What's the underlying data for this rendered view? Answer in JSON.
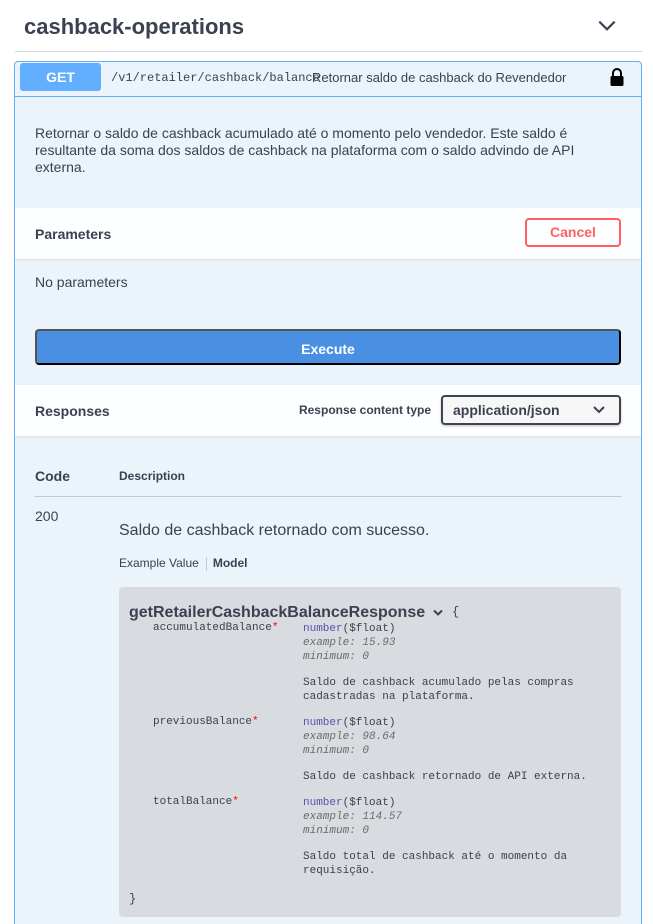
{
  "tag": {
    "title": "cashback-operations",
    "toggle_icon": "chevron-down-icon"
  },
  "operation": {
    "method": "GET",
    "path": "/v1/retailer/cashback/balance",
    "summary": "Retornar saldo de cashback do Revendedor",
    "lock_icon": "lock-icon",
    "description": "Retornar o saldo de cashback acumulado até o momento pelo vendedor. Este saldo é resultante da soma dos saldos de cashback na plataforma com o saldo advindo de API externa."
  },
  "parameters": {
    "title": "Parameters",
    "cancel_label": "Cancel",
    "empty_text": "No parameters",
    "execute_label": "Execute"
  },
  "responses": {
    "title": "Responses",
    "content_type_label": "Response content type",
    "content_type_value": "application/json",
    "col_code": "Code",
    "col_description": "Description",
    "rows": [
      {
        "code": "200",
        "description": "Saldo de cashback retornado com sucesso.",
        "tab_example": "Example Value",
        "tab_model": "Model"
      }
    ]
  },
  "model": {
    "name": "getRetailerCashbackBalanceResponse",
    "open_brace": "{",
    "close_brace": "}",
    "properties": [
      {
        "name": "accumulatedBalance",
        "required": "*",
        "type": "number",
        "format": "($float)",
        "example": "example: 15.93",
        "minimum": "minimum: 0",
        "description": "Saldo de cashback acumulado pelas compras cadastradas na plataforma."
      },
      {
        "name": "previousBalance",
        "required": "*",
        "type": "number",
        "format": "($float)",
        "example": "example: 98.64",
        "minimum": "minimum: 0",
        "description": "Saldo de cashback retornado de API externa."
      },
      {
        "name": "totalBalance",
        "required": "*",
        "type": "number",
        "format": "($float)",
        "example": "example: 114.57",
        "minimum": "minimum: 0",
        "description": "Saldo total de cashback até o momento da requisição."
      }
    ]
  },
  "colors": {
    "get_accent": "#61affe",
    "execute": "#4990e2",
    "cancel": "#ff6060"
  }
}
